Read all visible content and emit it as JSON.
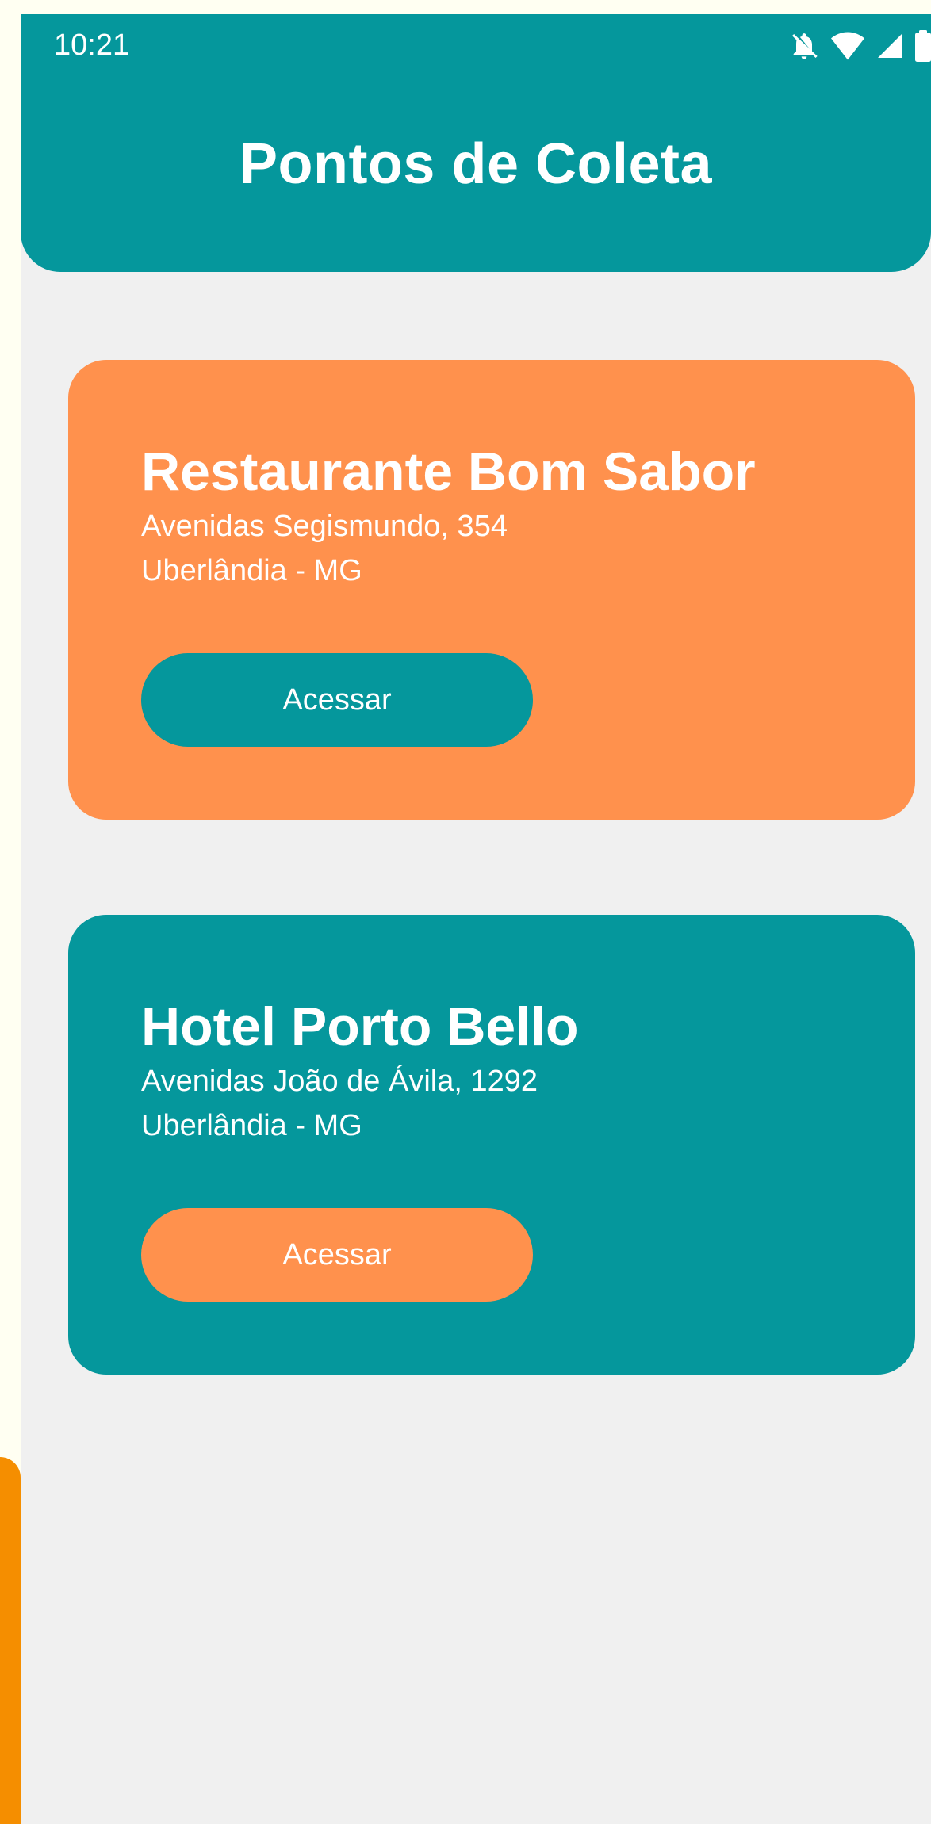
{
  "status_bar": {
    "time": "10:21",
    "icons": [
      "notifications-off-icon",
      "wifi-icon",
      "signal-icon",
      "battery-icon"
    ]
  },
  "header": {
    "title": "Pontos de Coleta"
  },
  "cards": [
    {
      "name": "Restaurante Bom Sabor",
      "address": "Avenidas Segismundo, 354",
      "city": "Uberlândia - MG",
      "button_label": "Acessar",
      "card_color": "#FF914D",
      "button_color": "#05979C"
    },
    {
      "name": "Hotel Porto Bello",
      "address": "Avenidas João de Ávila, 1292",
      "city": "Uberlândia - MG",
      "button_label": "Acessar",
      "card_color": "#05979C",
      "button_color": "#FF914D"
    }
  ],
  "colors": {
    "primary": "#05979C",
    "accent": "#FF914D",
    "background": "#F0F0F0",
    "frame_background": "#FFFFF2",
    "frame_accent": "#F58E00"
  }
}
